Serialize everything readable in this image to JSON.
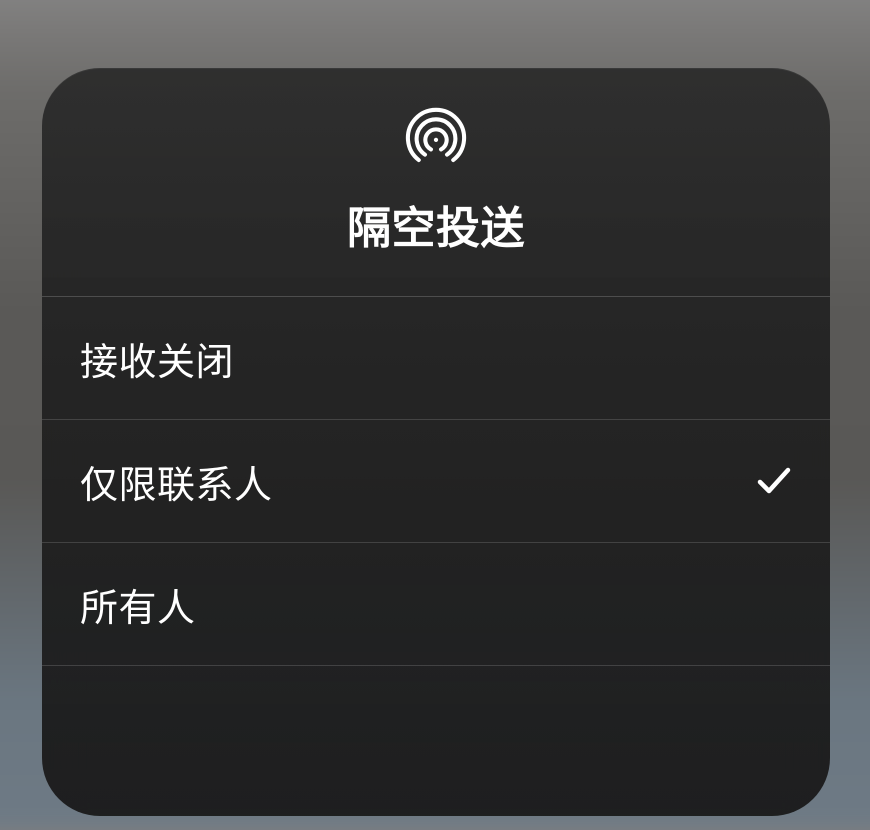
{
  "panel": {
    "title": "隔空投送",
    "options": [
      {
        "label": "接收关闭",
        "selected": false
      },
      {
        "label": "仅限联系人",
        "selected": true
      },
      {
        "label": "所有人",
        "selected": false
      }
    ]
  }
}
